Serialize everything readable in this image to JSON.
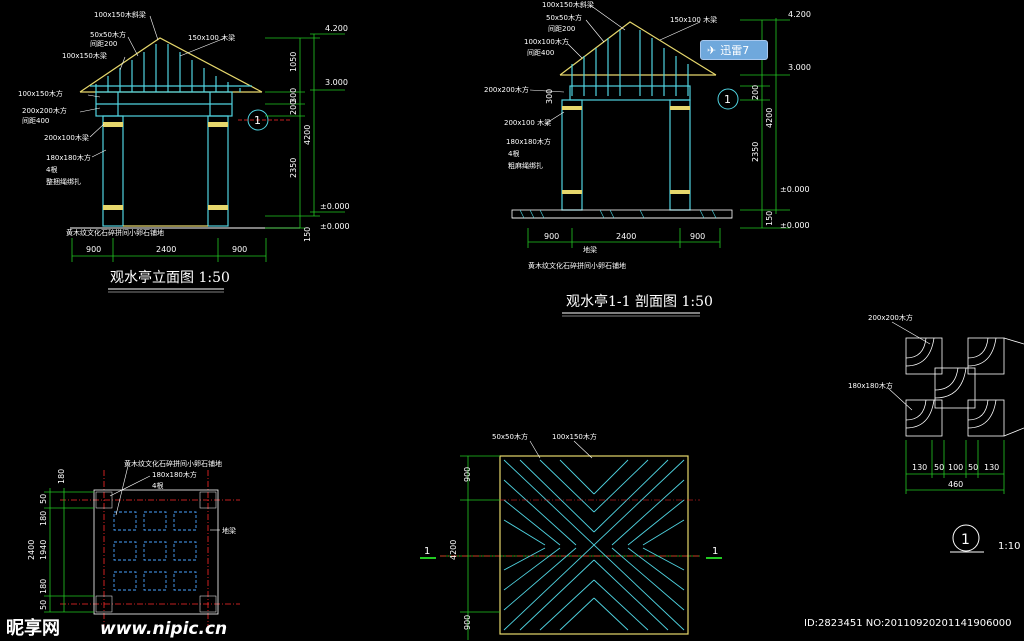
{
  "elevation": {
    "title": "观水亭立面图 1:50",
    "labels": [
      "100x150木斜梁",
      "50x50木方",
      "间距200",
      "100x150木梁",
      "100x150木方",
      "200x200木方",
      "间距400",
      "200x100木梁",
      "180x180木方",
      "4根",
      "整捆绳绑扎",
      "黄木纹文化石碎拼间小卵石铺地"
    ],
    "right_labels": [
      "150x100 木梁"
    ],
    "levels": [
      "4.200",
      "3.000",
      "±0.000",
      "±0.000"
    ],
    "vdims": [
      "1050",
      "300",
      "200",
      "4200",
      "2350",
      "150"
    ],
    "hdims": [
      "900",
      "2400",
      "900"
    ],
    "callout": "1"
  },
  "section": {
    "title": "观水亭1-1 剖面图 1:50",
    "labels": [
      "100x150木斜梁",
      "50x50木方",
      "间距200",
      "100x100木方",
      "间距400",
      "200x200木方",
      "200x100 木梁",
      "180x180木方",
      "4根",
      "粗麻绳绑扎",
      "黄木纹文化石碎拼间小卵石铺地",
      "地梁"
    ],
    "right_labels": [
      "150x100 木梁"
    ],
    "levels": [
      "4.200",
      "3.000",
      "±0.000",
      "±0.000"
    ],
    "vdims": [
      "300",
      "200",
      "4200",
      "2350",
      "150"
    ],
    "hdims": [
      "900",
      "2400",
      "900"
    ],
    "callout": "1"
  },
  "plan": {
    "labels": [
      "黄木纹文化石碎拼间小卵石铺地",
      "180x180木方",
      "4根",
      "地梁"
    ],
    "vdims": [
      "180",
      "50",
      "180",
      "2400",
      "1940",
      "180",
      "50"
    ],
    "section_mark": "1"
  },
  "roof": {
    "labels": [
      "50x50木方",
      "100x150木方"
    ],
    "vdims": [
      "900",
      "4200",
      "900"
    ],
    "section_mark": "1"
  },
  "detail": {
    "labels": [
      "200x200木方",
      "180x180木方"
    ],
    "hdims": [
      "130",
      "50",
      "100",
      "50",
      "130"
    ],
    "total": "460",
    "callout": "1",
    "scale": "1:10"
  },
  "badge": {
    "text": "迅雷7"
  },
  "watermark": {
    "logo": "昵享网",
    "url": "www.nipic.cn",
    "id": "ID:2823451 NO:20110920201141906000"
  },
  "colors": {
    "structure": "#4fd3e0",
    "timber": "#e6d76c",
    "dim": "#22c922",
    "axis": "#ff2a2a",
    "paving": "#4aa3ff"
  }
}
